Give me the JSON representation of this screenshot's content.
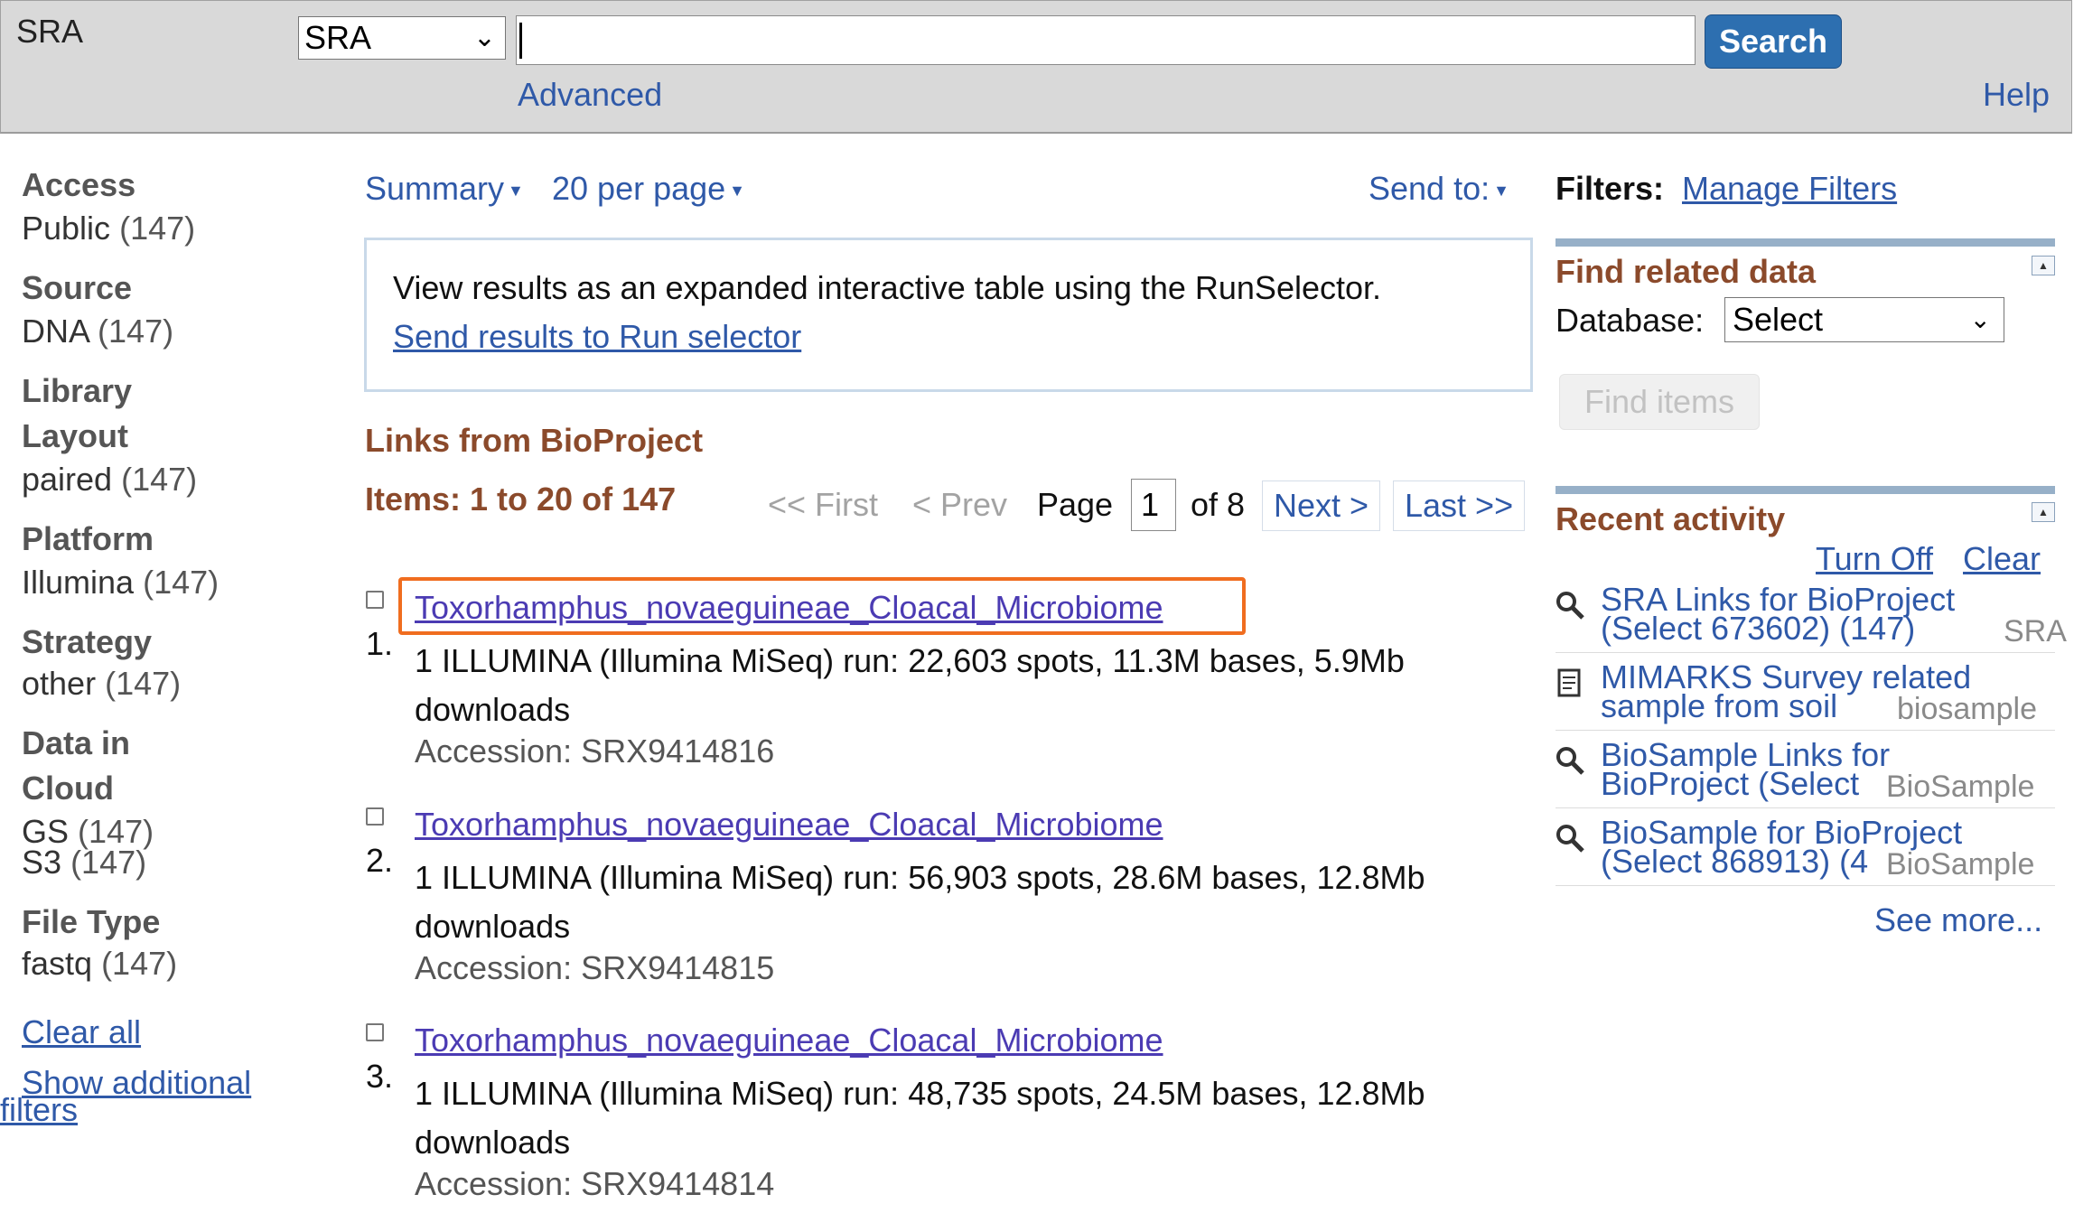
{
  "header": {
    "db_label": "SRA",
    "db_select_value": "SRA",
    "search_value": "",
    "search_button": "Search",
    "advanced_link": "Advanced",
    "help_link": "Help"
  },
  "facets": [
    {
      "heading": "Access",
      "value": "Public",
      "count": "(147)"
    },
    {
      "heading": "Source",
      "value": "DNA",
      "count": "(147)"
    },
    {
      "heading_l1": "Library",
      "heading_l2": "Layout",
      "value": "paired",
      "count": "(147)"
    },
    {
      "heading": "Platform",
      "value": "Illumina",
      "count": "(147)"
    },
    {
      "heading": "Strategy",
      "value": "other",
      "count": "(147)"
    },
    {
      "heading_l1": "Data in",
      "heading_l2": "Cloud",
      "value": "GS",
      "count": "(147)",
      "value2": "S3",
      "count2": "(147)"
    },
    {
      "heading": "File Type",
      "value": "fastq",
      "count": "(147)"
    }
  ],
  "sidebar_links": {
    "clear_all": "Clear all",
    "show_additional_l1": "Show additional",
    "show_additional_l2": "filters"
  },
  "toolbar": {
    "summary": "Summary",
    "per_page": "20 per page",
    "send_to": "Send to:"
  },
  "runselector": {
    "text": "View results as an expanded interactive table using the RunSelector.",
    "link": "Send results to Run selector"
  },
  "links_from": "Links from BioProject",
  "items_count": "Items: 1 to 20 of 147",
  "pagination": {
    "first": "<< First",
    "prev": "< Prev",
    "page_label": "Page",
    "page_value": "1",
    "of_label": "of 8",
    "next": "Next >",
    "last": "Last >>"
  },
  "results": [
    {
      "num": "1.",
      "title": "Toxorhamphus_novaeguineae_Cloacal_Microbiome",
      "desc": "1 ILLUMINA (Illumina MiSeq) run: 22,603 spots, 11.3M bases, 5.9Mb downloads",
      "accession": "Accession: SRX9414816"
    },
    {
      "num": "2.",
      "title": "Toxorhamphus_novaeguineae_Cloacal_Microbiome",
      "desc": "1 ILLUMINA (Illumina MiSeq) run: 56,903 spots, 28.6M bases, 12.8Mb downloads",
      "accession": "Accession: SRX9414815"
    },
    {
      "num": "3.",
      "title": "Toxorhamphus_novaeguineae_Cloacal_Microbiome",
      "desc": "1 ILLUMINA (Illumina MiSeq) run: 48,735 spots, 24.5M bases, 12.8Mb downloads",
      "accession": "Accession: SRX9414814"
    }
  ],
  "right": {
    "filters_label": "Filters:",
    "manage_filters": "Manage Filters",
    "find_related_heading": "Find related data",
    "database_label": "Database:",
    "database_value": "Select",
    "find_items": "Find items",
    "recent_heading": "Recent activity",
    "turn_off": "Turn Off",
    "clear": "Clear",
    "recent_items": [
      {
        "l1": "SRA Links for BioProject",
        "l2": "(Select 673602) (147)",
        "db": "SRA",
        "icon": "search-icon"
      },
      {
        "l1": "MIMARKS Survey related",
        "l2": "sample from soil",
        "db": "biosample",
        "icon": "document-icon"
      },
      {
        "l1": "BioSample Links for",
        "l2": "BioProject (Select",
        "db": "BioSample",
        "icon": "search-icon"
      },
      {
        "l1": "BioSample for BioProject",
        "l2": "(Select 868913) (4",
        "db": "BioSample",
        "icon": "search-icon"
      }
    ],
    "see_more": "See more..."
  },
  "colors": {
    "link": "#2f59a8",
    "visited_link": "#4b3bb3",
    "section_heading": "#8b4a2b",
    "search_button": "#2d6fb0",
    "highlight": "#f06d1f"
  }
}
